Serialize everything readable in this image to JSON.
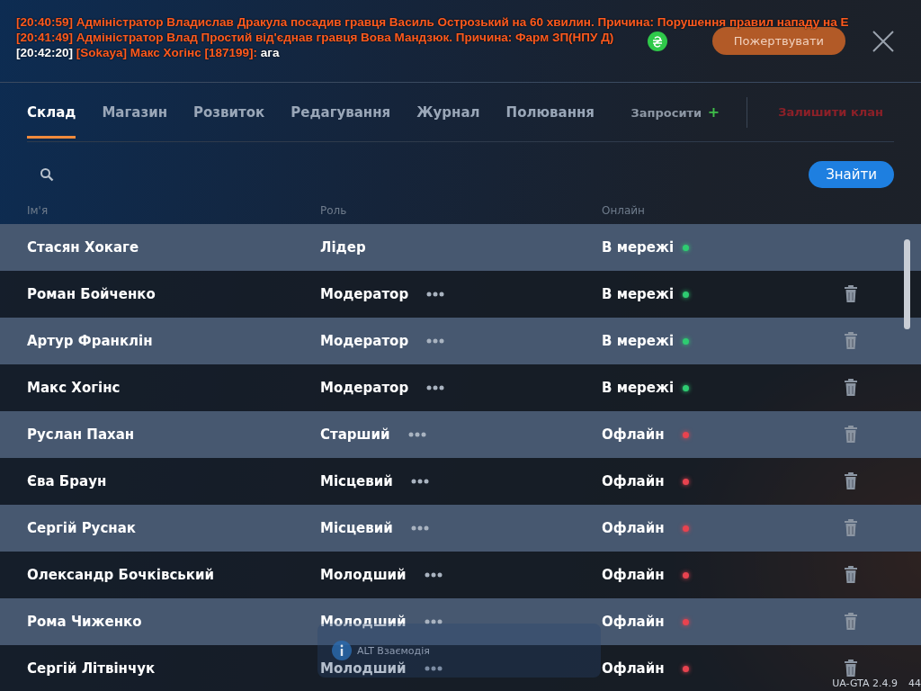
{
  "chat": [
    {
      "time": "[20:40:59]",
      "text": "Адміністратор Владислав Дракула посадив гравця Василь Острозький на 60 хвилин. Причина: Порушення правил нападу на Е",
      "kind": "admin"
    },
    {
      "time": "[20:41:49]",
      "text": "Адміністратор Влад Простий від'єднав гравця Вова Мандзюк. Причина: Фарм ЗП(НПУ Д)",
      "kind": "admin"
    },
    {
      "time": "[20:42:20]",
      "text": "[Sokaya] Макс Хогінс [187199]:",
      "message": "ага",
      "kind": "clan"
    }
  ],
  "header": {
    "donate_button": "Пожертвувати"
  },
  "tabs": [
    {
      "label": "Склад",
      "selected": true
    },
    {
      "label": "Магазин",
      "selected": false
    },
    {
      "label": "Розвиток",
      "selected": false
    },
    {
      "label": "Редагування",
      "selected": false
    },
    {
      "label": "Журнал",
      "selected": false
    },
    {
      "label": "Полювання",
      "selected": false
    }
  ],
  "invite_button": "Запросити",
  "invite_icon": "+",
  "leave_button": "Залишити клан",
  "search": {
    "button": "Знайти"
  },
  "table": {
    "columns": [
      "Ім'я",
      "Роль",
      "Онлайн"
    ],
    "rows": [
      {
        "name": "Стасян Хокаге",
        "role": "Лідер",
        "has_menu": false,
        "status": "В мережі",
        "color": "#2ecc71",
        "can_remove": false
      },
      {
        "name": "Роман Бойченко",
        "role": "Модератор",
        "has_menu": true,
        "status": "В мережі",
        "color": "#2ecc71",
        "can_remove": true
      },
      {
        "name": "Артур Франклін",
        "role": "Модератор",
        "has_menu": true,
        "status": "В мережі",
        "color": "#2ecc71",
        "can_remove": true
      },
      {
        "name": "Макс Хогінс",
        "role": "Модератор",
        "has_menu": true,
        "status": "В мережі",
        "color": "#2ecc71",
        "can_remove": true
      },
      {
        "name": "Руслан Пахан",
        "role": "Старший",
        "has_menu": true,
        "status": "Офлайн",
        "color": "#e8434f",
        "can_remove": true
      },
      {
        "name": "Єва Браун",
        "role": "Місцевий",
        "has_menu": true,
        "status": "Офлайн",
        "color": "#e8434f",
        "can_remove": true
      },
      {
        "name": "Сергій Руснак",
        "role": "Місцевий",
        "has_menu": true,
        "status": "Офлайн",
        "color": "#e8434f",
        "can_remove": true
      },
      {
        "name": "Олександр Бочківський",
        "role": "Молодший",
        "has_menu": true,
        "status": "Офлайн",
        "color": "#e8434f",
        "can_remove": true
      },
      {
        "name": "Рома Чиженко",
        "role": "Молодший",
        "has_menu": true,
        "status": "Офлайн",
        "color": "#e8434f",
        "can_remove": true
      },
      {
        "name": "Сергій Літвінчук",
        "role": "Молодший",
        "has_menu": true,
        "status": "Офлайн",
        "color": "#e8434f",
        "can_remove": true
      }
    ]
  },
  "hint": {
    "key": "ALT",
    "text": "Взаємодія"
  },
  "version": "UA-GTA 2.4.9",
  "counter": "44"
}
